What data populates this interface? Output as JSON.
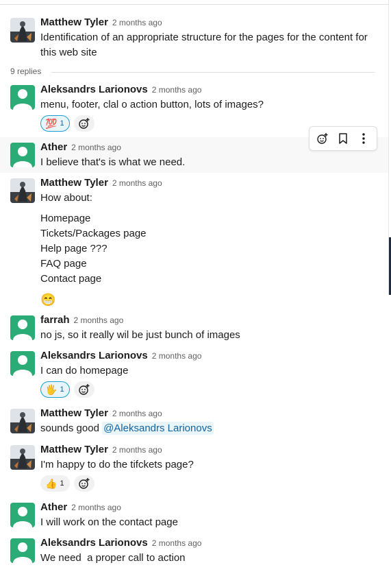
{
  "thread": {
    "replies_label": "9 replies"
  },
  "toolbar": {
    "icons": [
      "add-reaction-icon",
      "bookmark-icon",
      "more-vertical-icon"
    ]
  },
  "colors": {
    "generic_avatar": "#2bac76",
    "mention_bg": "#e8f5fa",
    "mention_text": "#1264a3"
  },
  "messages": [
    {
      "author": "Matthew Tyler",
      "time": "2 months ago",
      "lines": [
        "Identification of an appropriate structure for the pages for the content for this web site"
      ]
    },
    {
      "author": "Aleksandrs Larionovs",
      "time": "2 months ago",
      "lines": [
        "menu, footer, clal o action button, lots of images?"
      ],
      "reactions": [
        {
          "emoji": "💯",
          "count": "1"
        }
      ]
    },
    {
      "author": "Ather",
      "time": "2 months ago",
      "lines": [
        "I believe that's is what we need."
      ]
    },
    {
      "author": "Matthew Tyler",
      "time": "2 months ago",
      "lines": [
        "How about:",
        "Homepage",
        "Tickets/Packages page",
        "Help page ???",
        "FAQ page",
        "Contact page",
        "😁"
      ]
    },
    {
      "author": "farrah",
      "time": "2 months ago",
      "lines": [
        "no js, so it really wil be just bunch of images"
      ]
    },
    {
      "author": "Aleksandrs Larionovs",
      "time": "2 months ago",
      "lines": [
        "I can do homepage"
      ],
      "reactions": [
        {
          "emoji": "🖐️",
          "count": "1"
        }
      ]
    },
    {
      "author": "Matthew Tyler",
      "time": "2 months ago",
      "lines": [
        "sounds good"
      ],
      "mention": "@Aleksandrs Larionovs"
    },
    {
      "author": "Matthew Tyler",
      "time": "2 months ago",
      "lines": [
        "I'm happy to do the tifckets page?"
      ],
      "reactions": [
        {
          "emoji": "👍",
          "count": "1"
        }
      ]
    },
    {
      "author": "Ather",
      "time": "2 months ago",
      "lines": [
        "I will work on the contact page"
      ]
    },
    {
      "author": "Aleksandrs Larionovs",
      "time": "2 months ago",
      "lines": [
        "We need  a proper call to action"
      ]
    }
  ]
}
